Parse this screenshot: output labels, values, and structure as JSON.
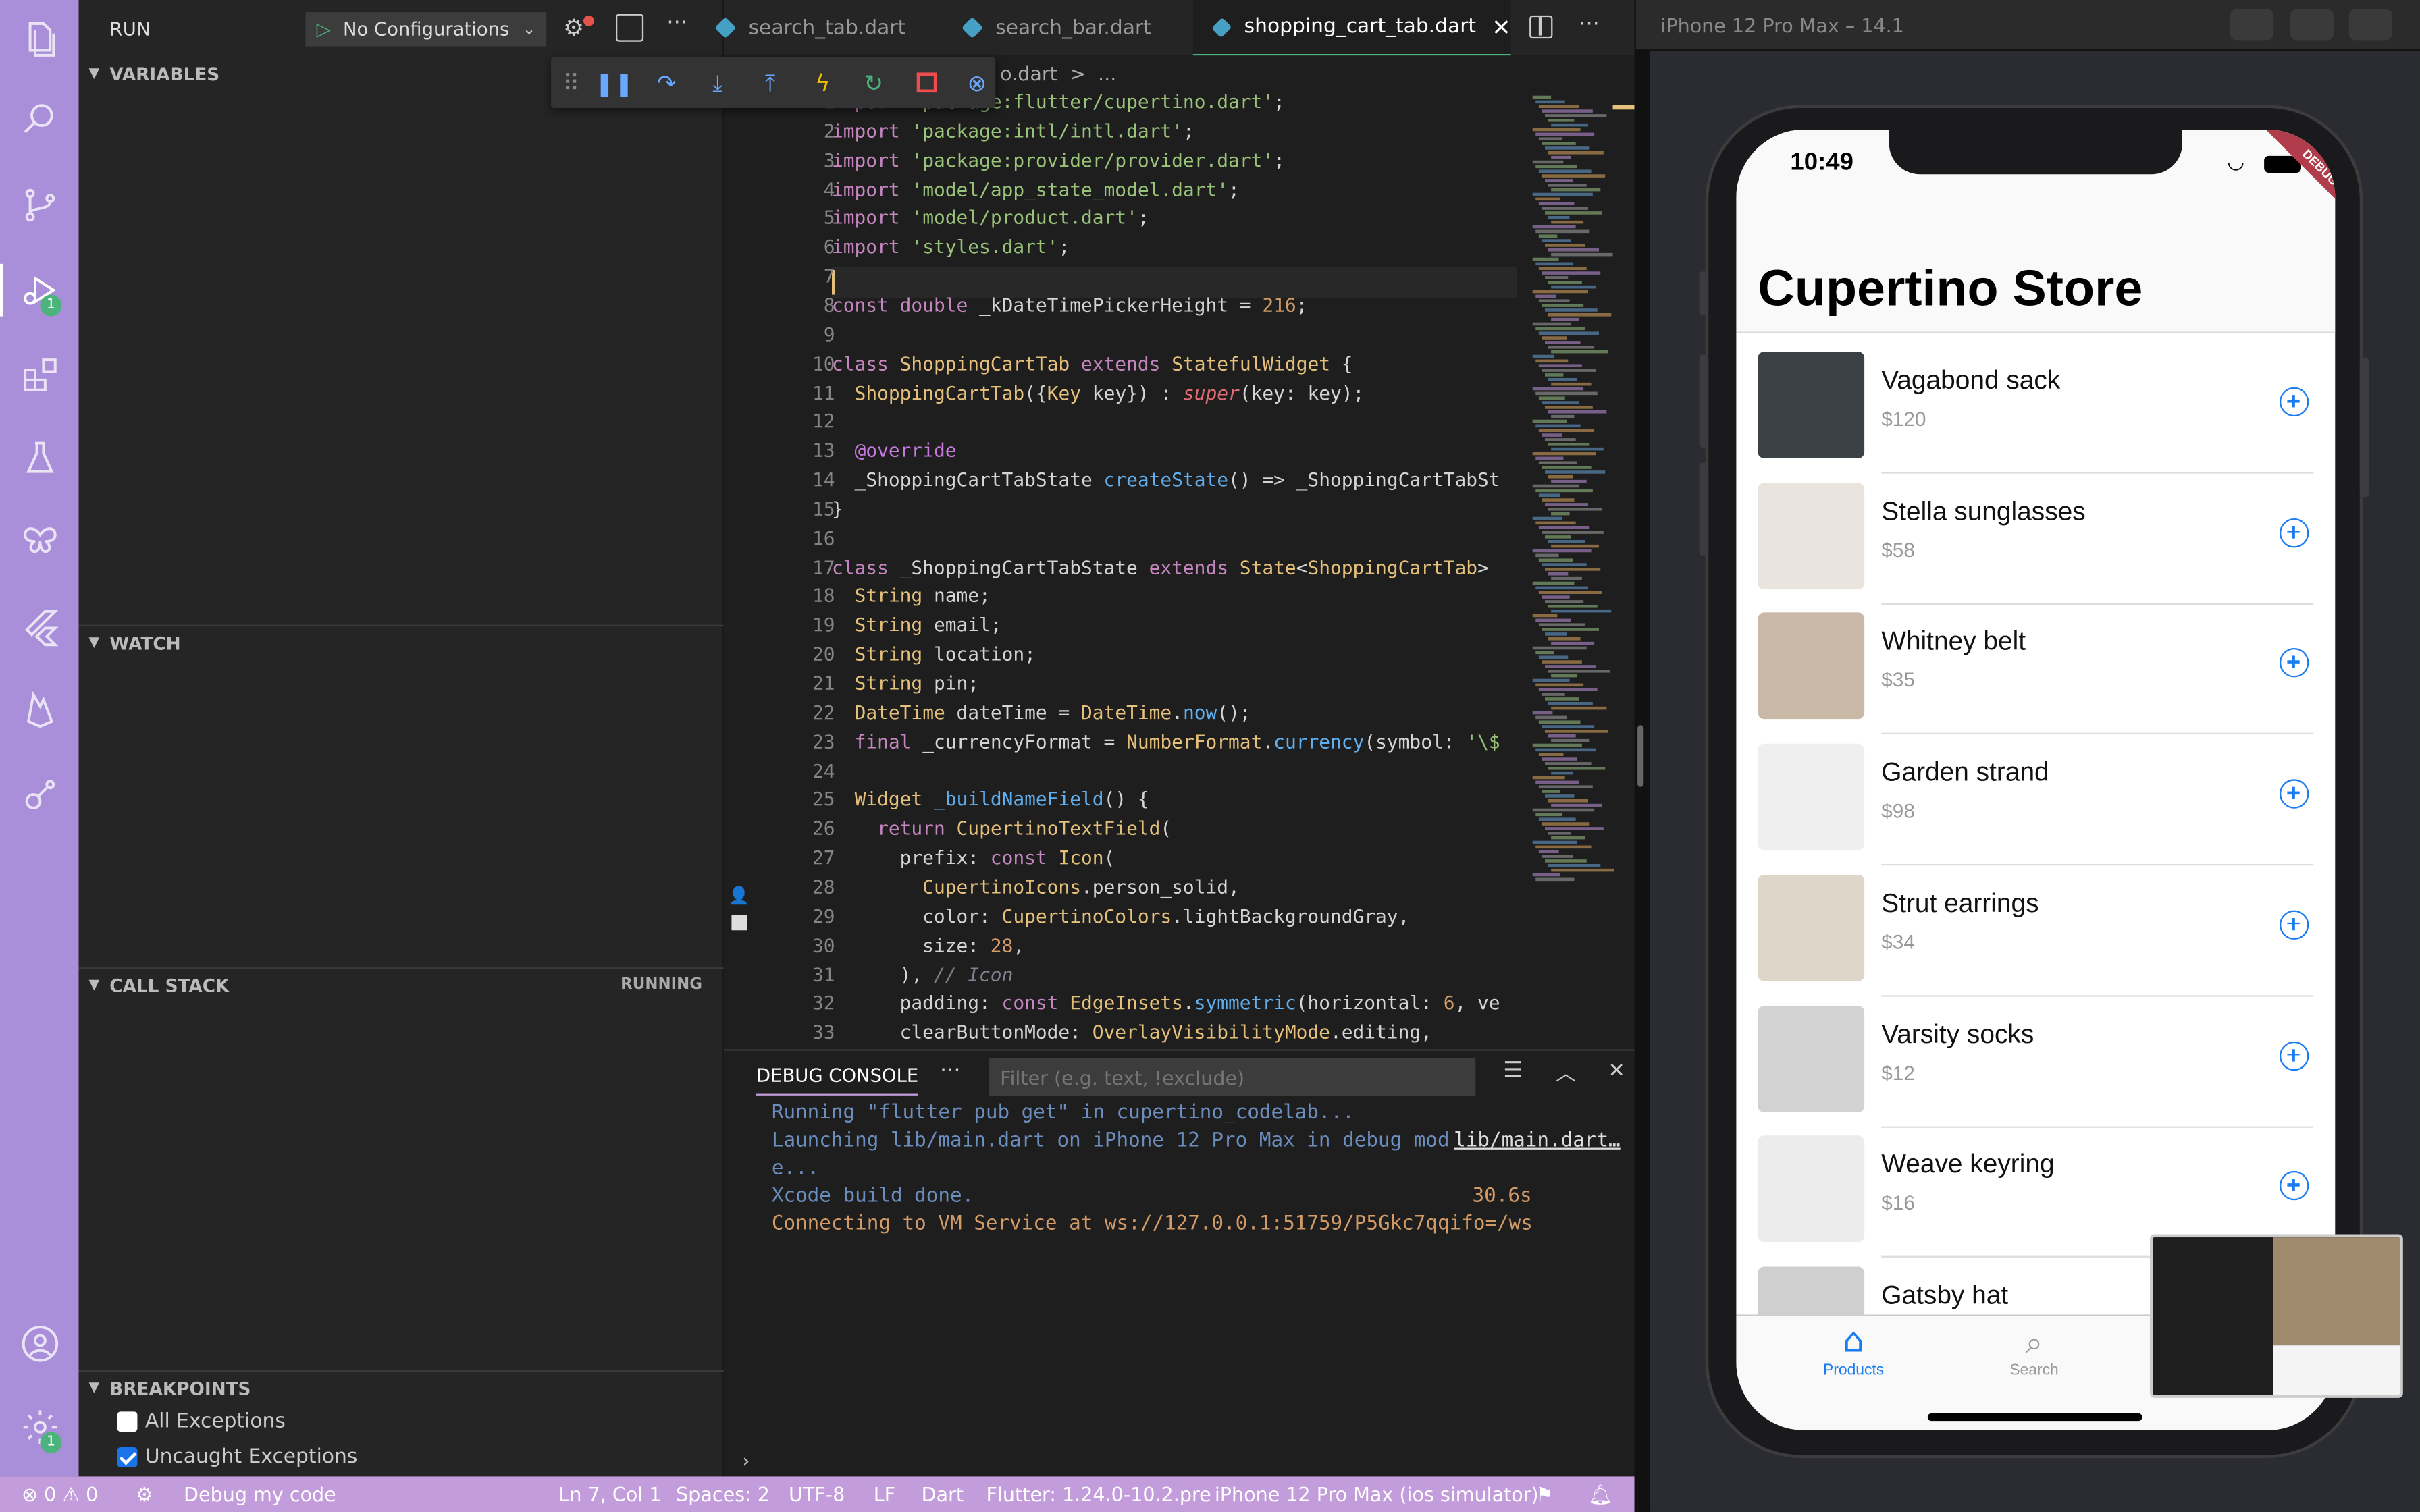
{
  "run": {
    "title": "RUN",
    "config": "No Configurations"
  },
  "sections": {
    "variables": "VARIABLES",
    "watch": "WATCH",
    "callstack": "CALL STACK",
    "running": "RUNNING",
    "breakpoints": "BREAKPOINTS"
  },
  "breakpoints": [
    {
      "label": "All Exceptions",
      "checked": false
    },
    {
      "label": "Uncaught Exceptions",
      "checked": true
    }
  ],
  "activity": {
    "debug_badge": "1",
    "settings_badge": "1"
  },
  "tabs": [
    "search_tab.dart",
    "search_bar.dart",
    "shopping_cart_tab.dart"
  ],
  "breadcrumb": "o.dart  >  ...",
  "code_lines": [
    "import 'package:flutter/cupertino.dart';",
    "import 'package:intl/intl.dart';",
    "import 'package:provider/provider.dart';",
    "import 'model/app_state_model.dart';",
    "import 'model/product.dart';",
    "import 'styles.dart';",
    "",
    "const double _kDateTimePickerHeight = 216;",
    "",
    "class ShoppingCartTab extends StatefulWidget {",
    "  ShoppingCartTab({Key key}) : super(key: key);",
    "",
    "  @override",
    "  _ShoppingCartTabState createState() => _ShoppingCartTabSt",
    "}",
    "",
    "class _ShoppingCartTabState extends State<ShoppingCartTab>",
    "  String name;",
    "  String email;",
    "  String location;",
    "  String pin;",
    "  DateTime dateTime = DateTime.now();",
    "  final _currencyFormat = NumberFormat.currency(symbol: '\\$",
    "",
    "  Widget _buildNameField() {",
    "    return CupertinoTextField(",
    "      prefix: const Icon(",
    "        CupertinoIcons.person_solid,",
    "        color: CupertinoColors.lightBackgroundGray,",
    "        size: 28,",
    "      ), // Icon",
    "      padding: const EdgeInsets.symmetric(horizontal: 6, ve",
    "      clearButtonMode: OverlayVisibilityMode.editing,"
  ],
  "panel": {
    "tab": "DEBUG CONSOLE",
    "filter_placeholder": "Filter (e.g. text, !exclude)"
  },
  "console": [
    "Running \"flutter pub get\" in cupertino_codelab...",
    "Launching lib/main.dart on iPhone 12 Pro Max in debug mod",
    "e...",
    "Xcode build done.",
    "Connecting to VM Service at ws://127.0.0.1:51759/P5Gkc7qqifo=/ws"
  ],
  "console_link": "lib/main.dart…",
  "console_time": "30.6s",
  "status": {
    "errors": "0",
    "warnings": "0",
    "debug": "Debug my code",
    "position": "Ln 7, Col 1",
    "spaces": "Spaces: 2",
    "encoding": "UTF-8",
    "eol": "LF",
    "lang": "Dart",
    "flutter": "Flutter: 1.24.0-10.2.pre",
    "device": "iPhone 12 Pro Max (ios simulator)"
  },
  "simulator": {
    "title": "iPhone 12 Pro Max – 14.1",
    "time": "10:49",
    "debug_banner": "DEBUG",
    "store_title": "Cupertino Store",
    "products": [
      {
        "name": "Vagabond sack",
        "price": "$120"
      },
      {
        "name": "Stella sunglasses",
        "price": "$58"
      },
      {
        "name": "Whitney belt",
        "price": "$35"
      },
      {
        "name": "Garden strand",
        "price": "$98"
      },
      {
        "name": "Strut earrings",
        "price": "$34"
      },
      {
        "name": "Varsity socks",
        "price": "$12"
      },
      {
        "name": "Weave keyring",
        "price": "$16"
      },
      {
        "name": "Gatsby hat",
        "price": ""
      }
    ],
    "tabbar": {
      "products": "Products",
      "search": "Search"
    }
  },
  "colors": {
    "activity_bar": "#a98fda",
    "status_bar": "#c39ddb",
    "ios_blue": "#1a7cf0"
  }
}
